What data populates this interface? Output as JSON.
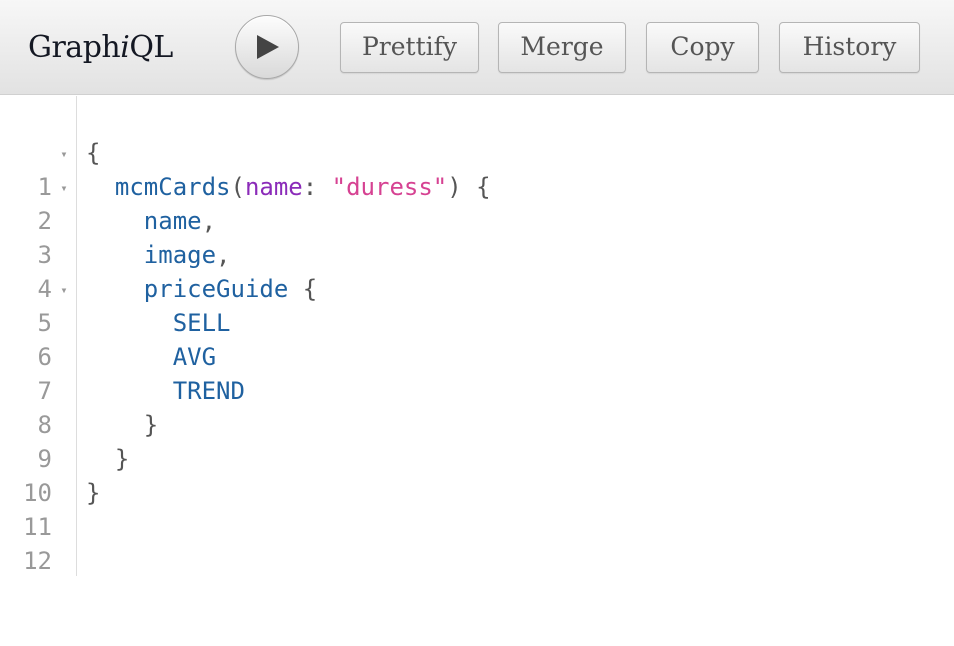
{
  "app": {
    "title_prefix": "Graph",
    "title_italic": "i",
    "title_suffix": "QL"
  },
  "toolbar": {
    "run_icon": "play-icon",
    "buttons": [
      "Prettify",
      "Merge",
      "Copy",
      "History"
    ]
  },
  "editor": {
    "line_numbers": [
      "1",
      "2",
      "3",
      "4",
      "5",
      "6",
      "7",
      "8",
      "9",
      "10",
      "11",
      "12"
    ],
    "fold_marker": "▾",
    "tokens": {
      "l1_brace": "{",
      "l2_field": "mcmCards",
      "l2_paren_open": "(",
      "l2_arg": "name",
      "l2_colon": ": ",
      "l2_string": "\"duress\"",
      "l2_paren_close": ")",
      "l2_brace": " {",
      "l3_field": "name",
      "l3_comma": ",",
      "l4_field": "image",
      "l4_comma": ",",
      "l5_field": "priceGuide",
      "l5_brace": " {",
      "l6_field": "SELL",
      "l7_field": "AVG",
      "l8_field": "TREND",
      "l9_brace": "}",
      "l10_brace": "}",
      "l11_brace": "}"
    }
  },
  "colors": {
    "field": "#1f61a0",
    "argument": "#8b2bb9",
    "string": "#d64292",
    "punctuation": "#555555",
    "line_number": "#999999"
  }
}
